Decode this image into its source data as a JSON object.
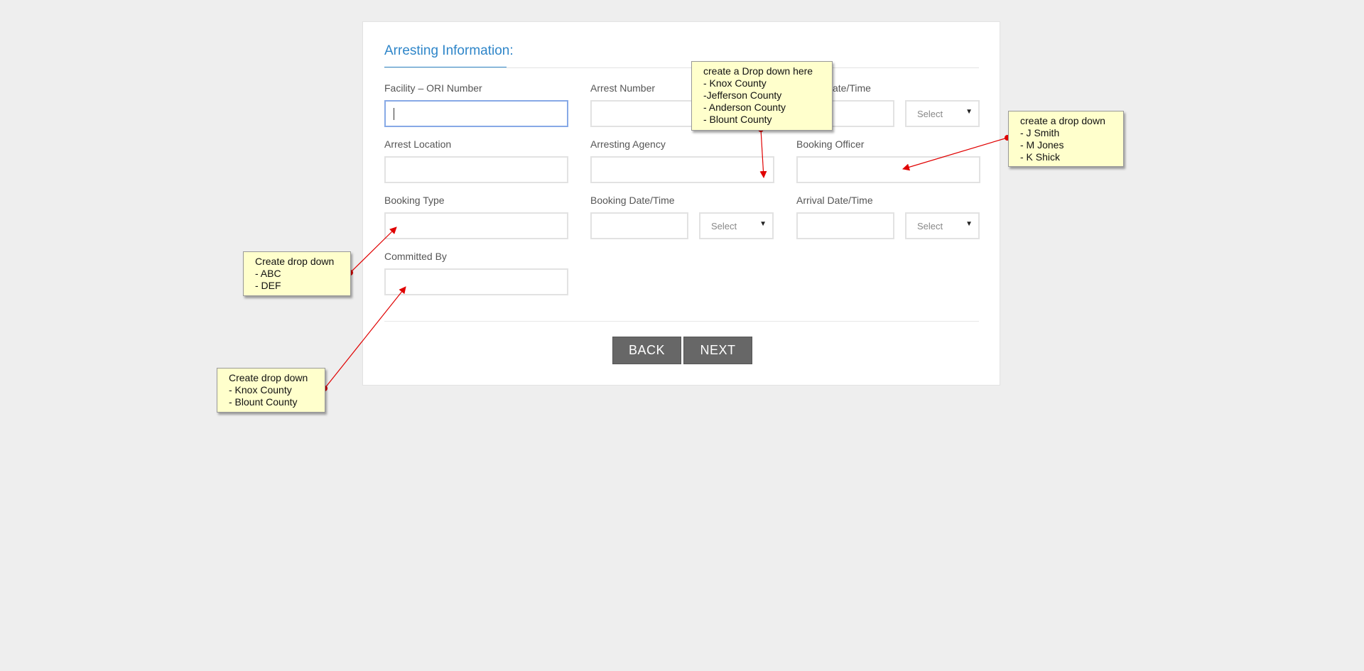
{
  "form": {
    "section_title": "Arresting Information:",
    "fields": {
      "facility_ori": {
        "label": "Facility – ORI Number",
        "value": ""
      },
      "arrest_number": {
        "label": "Arrest Number",
        "value": ""
      },
      "arrest_datetime": {
        "label": "ate/Time",
        "select_value": "Select"
      },
      "arrest_location": {
        "label": "Arrest Location",
        "value": ""
      },
      "arresting_agency": {
        "label": "Arresting Agency",
        "value": ""
      },
      "booking_officer": {
        "label": "Booking Officer",
        "value": ""
      },
      "booking_type": {
        "label": "Booking Type",
        "value": ""
      },
      "booking_datetime": {
        "label": "Booking Date/Time",
        "select_value": "Select"
      },
      "arrival_datetime": {
        "label": "Arrival Date/Time",
        "select_value": "Select"
      },
      "committed_by": {
        "label": "Committed By",
        "value": ""
      }
    },
    "buttons": {
      "back": "BACK",
      "next": "NEXT"
    }
  },
  "annotations": {
    "agency_note": {
      "lines": [
        "create a Drop down here",
        "- Knox County",
        "-Jefferson County",
        "- Anderson County",
        "- Blount County"
      ]
    },
    "officer_note": {
      "lines": [
        "create a drop down",
        "- J Smith",
        "- M Jones",
        "- K Shick"
      ]
    },
    "booking_type_note": {
      "lines": [
        "Create drop down",
        "- ABC",
        "- DEF"
      ]
    },
    "committed_by_note": {
      "lines": [
        "Create drop down",
        "- Knox County",
        "- Blount County"
      ]
    },
    "note_color": "#ffffcc",
    "arrow_color": "#e00000"
  },
  "colors": {
    "accent": "#2f86c9",
    "button_bg": "#676767",
    "page_bg": "#eeeeee"
  }
}
